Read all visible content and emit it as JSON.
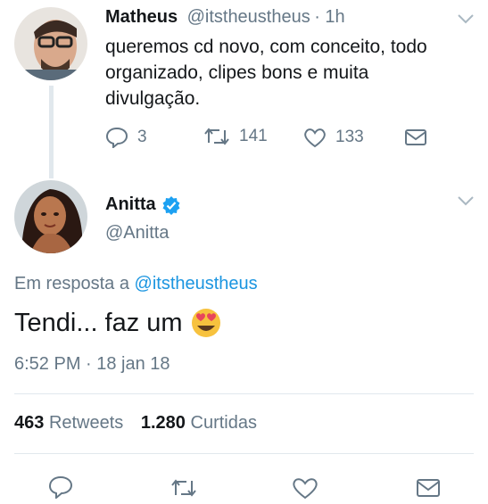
{
  "reply_tweet": {
    "name": "Matheus",
    "handle": "@itstheustheus",
    "time": "· 1h",
    "lines": [
      "queremos cd novo, com conceito, todo",
      "organizado, clipes bons e muita",
      "divulgação."
    ],
    "replies": "3",
    "retweets": "141",
    "likes": "133"
  },
  "main_tweet": {
    "name": "Anitta",
    "handle": "@Anitta",
    "reply_prefix": "Em resposta a",
    "reply_to": "@itstheustheus",
    "text": "Tendi... faz um",
    "emoji": "heart-eyes-emoji",
    "timestamp": "6:52 PM · 18 jan 18",
    "retweet_count": "463",
    "retweet_label": "Retweets",
    "like_count": "1.280",
    "like_label": "Curtidas"
  },
  "colors": {
    "link": "#1b95e0",
    "secondary": "#657786",
    "verified": "#1da1f2",
    "divider": "#e1e8ed"
  }
}
